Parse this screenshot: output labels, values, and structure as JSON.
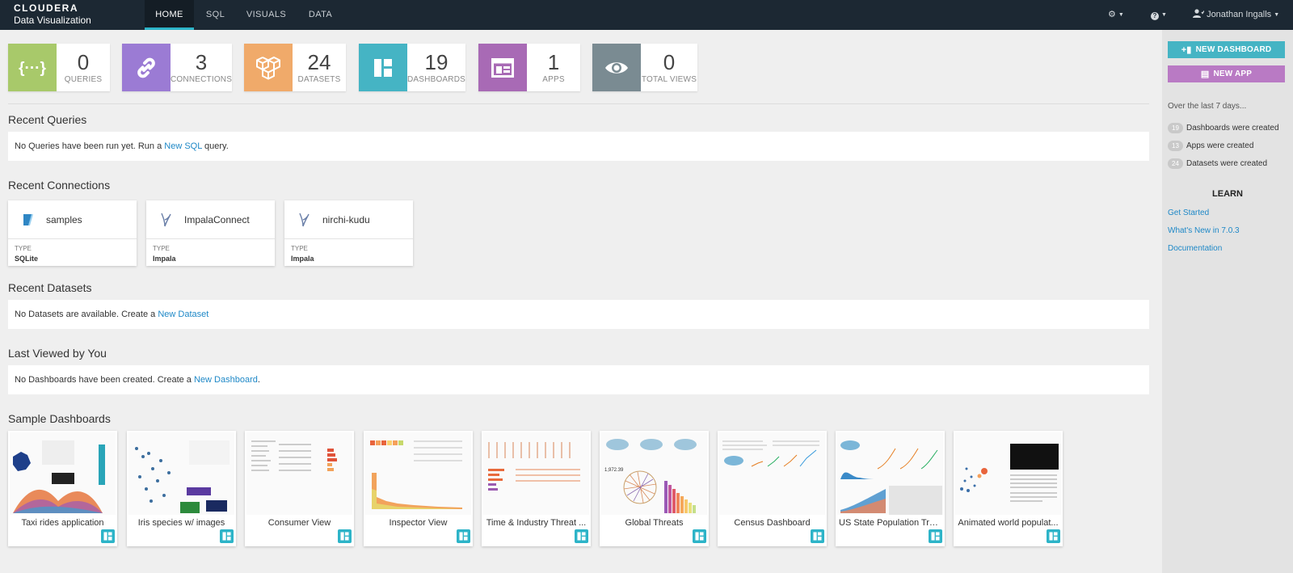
{
  "brand": {
    "line1": "CLOUDERA",
    "line2": "Data Visualization"
  },
  "nav": {
    "tabs": [
      "HOME",
      "SQL",
      "VISUALS",
      "DATA"
    ],
    "user": "Jonathan Ingalls"
  },
  "stats": [
    {
      "value": "0",
      "label": "QUERIES",
      "color": "#a8c96a",
      "icon": "curly-braces-icon"
    },
    {
      "value": "3",
      "label": "CONNECTIONS",
      "color": "#9b7bd4",
      "icon": "link-icon"
    },
    {
      "value": "24",
      "label": "DATASETS",
      "color": "#f0aa6a",
      "icon": "cubes-icon"
    },
    {
      "value": "19",
      "label": "DASHBOARDS",
      "color": "#45b4c4",
      "icon": "dashboard-icon"
    },
    {
      "value": "1",
      "label": "APPS",
      "color": "#a86ab5",
      "icon": "app-icon"
    },
    {
      "value": "0",
      "label": "TOTAL VIEWS",
      "color": "#7a8b92",
      "icon": "eye-icon"
    }
  ],
  "recent_queries": {
    "title": "Recent Queries",
    "text": "No Queries have been run yet. Run a ",
    "link": "New SQL",
    "suffix": " query."
  },
  "recent_connections": {
    "title": "Recent Connections",
    "items": [
      {
        "name": "samples",
        "type_label": "TYPE",
        "type": "SQLite",
        "icon": "sqlite-icon"
      },
      {
        "name": "ImpalaConnect",
        "type_label": "TYPE",
        "type": "Impala",
        "icon": "impala-icon"
      },
      {
        "name": "nirchi-kudu",
        "type_label": "TYPE",
        "type": "Impala",
        "icon": "impala-icon"
      }
    ]
  },
  "recent_datasets": {
    "title": "Recent Datasets",
    "text": "No Datasets are available. Create a ",
    "link": "New Dataset"
  },
  "last_viewed": {
    "title": "Last Viewed by You",
    "text": "No Dashboards have been created. Create a ",
    "link": "New Dashboard",
    "suffix": "."
  },
  "sample_dashboards": {
    "title": "Sample Dashboards",
    "items": [
      "Taxi rides application",
      "Iris species w/ images",
      "Consumer View",
      "Inspector View",
      "Time & Industry Threat ...",
      "Global Threats",
      "Census Dashboard",
      "US State Population Tre...",
      "Animated world populat..."
    ]
  },
  "sidebar": {
    "new_dashboard": "NEW DASHBOARD",
    "new_app": "NEW APP",
    "period": "Over the last 7 days...",
    "stats": [
      {
        "count": "19",
        "text": "Dashboards were created"
      },
      {
        "count": "13",
        "text": "Apps were created"
      },
      {
        "count": "24",
        "text": "Datasets were created"
      }
    ],
    "learn_title": "LEARN",
    "links": [
      "Get Started",
      "What's New in 7.0.3",
      "Documentation"
    ],
    "colors": {
      "dashboard_button": "#45b4c4",
      "app_button": "#b97ac4"
    }
  }
}
